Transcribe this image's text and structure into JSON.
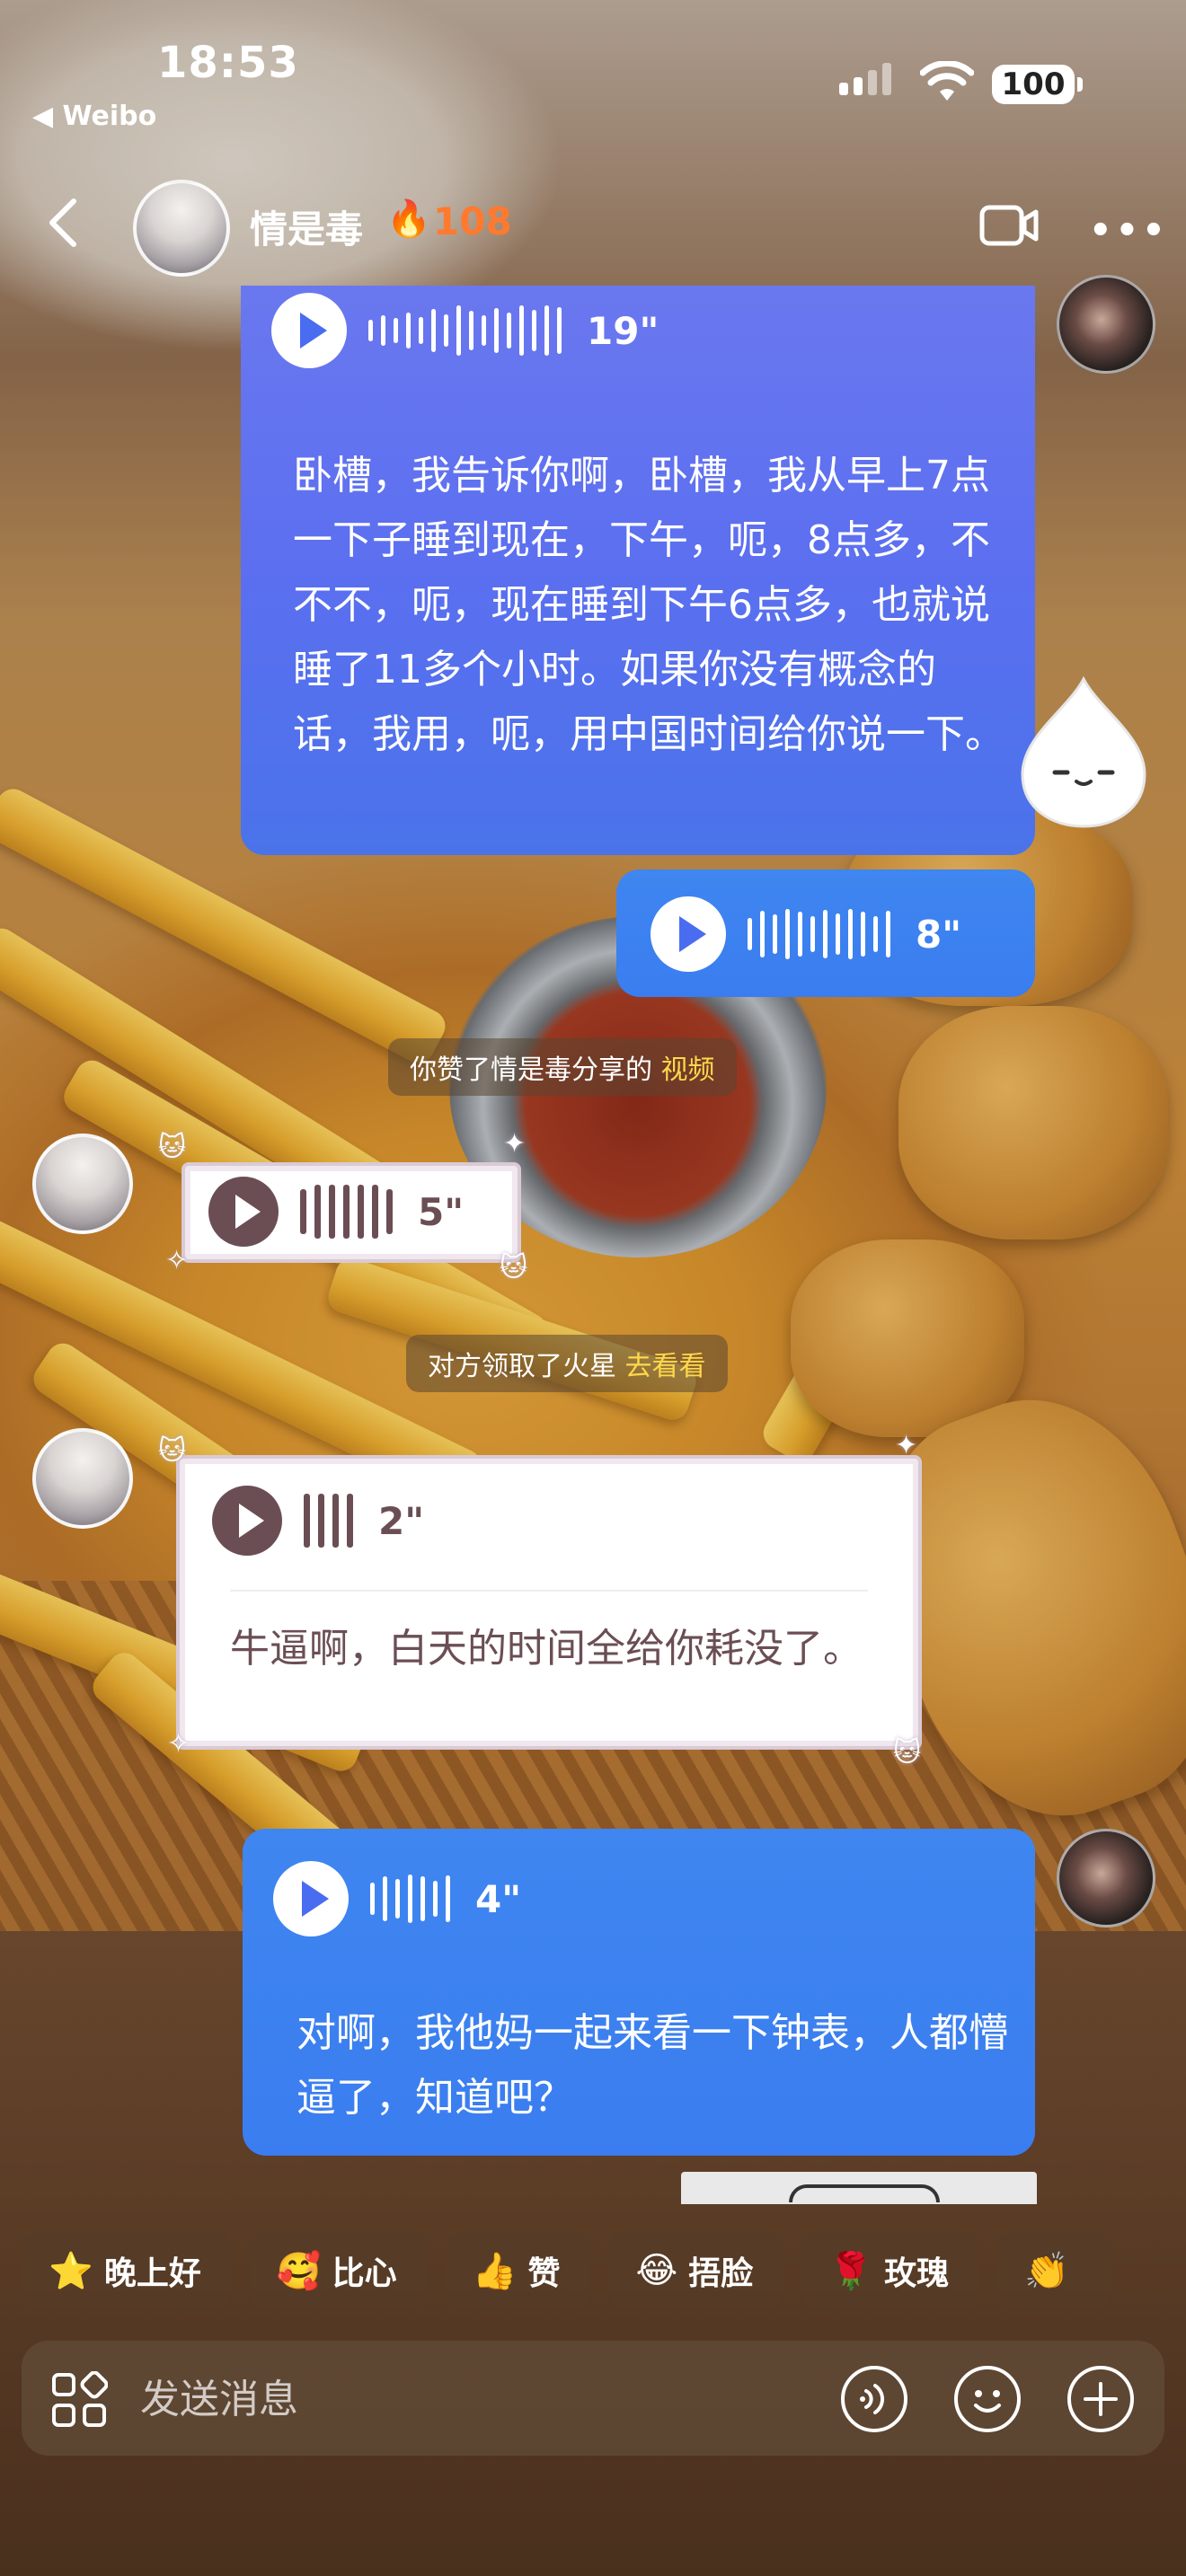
{
  "status_bar": {
    "time": "18:53",
    "back_app": "◀ Weibo",
    "battery": "100"
  },
  "header": {
    "title": "情是毒",
    "fire_icon": "🔥",
    "heat": "108",
    "more": "•••"
  },
  "messages": [
    {
      "side": "right",
      "type": "voice+text",
      "duration": "19\"",
      "text": "卧槽，我告诉你啊，卧槽，我从早上7点一下子睡到现在，下午，呃，8点多，不不不，呃，现在睡到下午6点多，也就说睡了11多个小时。如果你没有概念的话，我用，呃，用中国时间给你说一下。"
    },
    {
      "side": "right",
      "type": "voice",
      "duration": "8\""
    },
    {
      "side": "center",
      "type": "notice",
      "text": "你赞了情是毒分享的",
      "link": "视频"
    },
    {
      "side": "left",
      "type": "voice",
      "duration": "5\""
    },
    {
      "side": "center",
      "type": "notice",
      "text": "对方领取了火星",
      "link": "去看看"
    },
    {
      "side": "left",
      "type": "voice+text",
      "duration": "2\"",
      "text": "牛逼啊，白天的时间全给你耗没了。"
    },
    {
      "side": "right",
      "type": "voice+text",
      "duration": "4\"",
      "text": "对啊，我他妈一起来看一下钟表，人都懵逼了，知道吧？"
    }
  ],
  "quick_replies": [
    {
      "emoji": "⭐",
      "label": "晚上好"
    },
    {
      "emoji": "🥰",
      "label": "比心"
    },
    {
      "emoji": "👍",
      "label": "赞"
    },
    {
      "emoji": "😂",
      "label": "捂脸"
    },
    {
      "emoji": "🌹",
      "label": "玫瑰"
    },
    {
      "emoji": "👏",
      "label": ""
    }
  ],
  "input": {
    "placeholder": "发送消息"
  },
  "colors": {
    "bubble_blue": "#5b6ff0",
    "bubble_blue_bottom": "#3a7df0",
    "heat_orange": "#ff7a2f",
    "link_yellow": "#ffd84a",
    "friend_text": "#6b4e54"
  }
}
